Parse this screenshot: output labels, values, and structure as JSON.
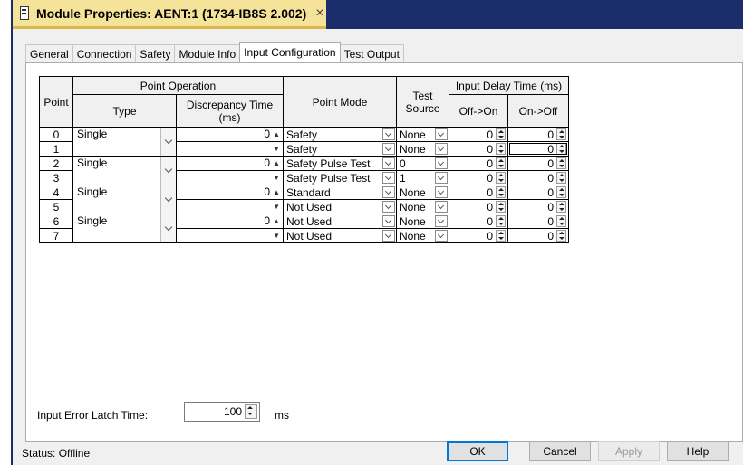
{
  "window": {
    "title": "Module Properties: AENT:1 (1734-IB8S 2.002)",
    "close_glyph": "×"
  },
  "tabs": [
    "General",
    "Connection",
    "Safety",
    "Module Info",
    "Input Configuration",
    "Test Output"
  ],
  "active_tab": "Input Configuration",
  "table": {
    "headers": {
      "point": "Point",
      "point_operation": "Point Operation",
      "type": "Type",
      "discrepancy_time": "Discrepancy Time (ms)",
      "point_mode": "Point Mode",
      "test_source": "Test Source",
      "input_delay": "Input Delay Time (ms)",
      "off_on": "Off->On",
      "on_off": "On->Off"
    },
    "pairs": [
      {
        "type": "Single",
        "discrepancy": "0"
      },
      {
        "type": "Single",
        "discrepancy": "0"
      },
      {
        "type": "Single",
        "discrepancy": "0"
      },
      {
        "type": "Single",
        "discrepancy": "0"
      }
    ],
    "rows": [
      {
        "point": "0",
        "mode": "Safety",
        "test_source": "None",
        "off_on": "0",
        "on_off": "0"
      },
      {
        "point": "1",
        "mode": "Safety",
        "test_source": "None",
        "off_on": "0",
        "on_off": "0"
      },
      {
        "point": "2",
        "mode": "Safety Pulse Test",
        "test_source": "0",
        "off_on": "0",
        "on_off": "0"
      },
      {
        "point": "3",
        "mode": "Safety Pulse Test",
        "test_source": "1",
        "off_on": "0",
        "on_off": "0"
      },
      {
        "point": "4",
        "mode": "Standard",
        "test_source": "None",
        "off_on": "0",
        "on_off": "0"
      },
      {
        "point": "5",
        "mode": "Not Used",
        "test_source": "None",
        "off_on": "0",
        "on_off": "0"
      },
      {
        "point": "6",
        "mode": "Not Used",
        "test_source": "None",
        "off_on": "0",
        "on_off": "0"
      },
      {
        "point": "7",
        "mode": "Not Used",
        "test_source": "None",
        "off_on": "0",
        "on_off": "0"
      }
    ]
  },
  "latch": {
    "label": "Input Error Latch Time:",
    "value": "100",
    "unit": "ms"
  },
  "status": "Status:  Offline",
  "buttons": {
    "ok": "OK",
    "cancel": "Cancel",
    "apply": "Apply",
    "help": "Help"
  }
}
